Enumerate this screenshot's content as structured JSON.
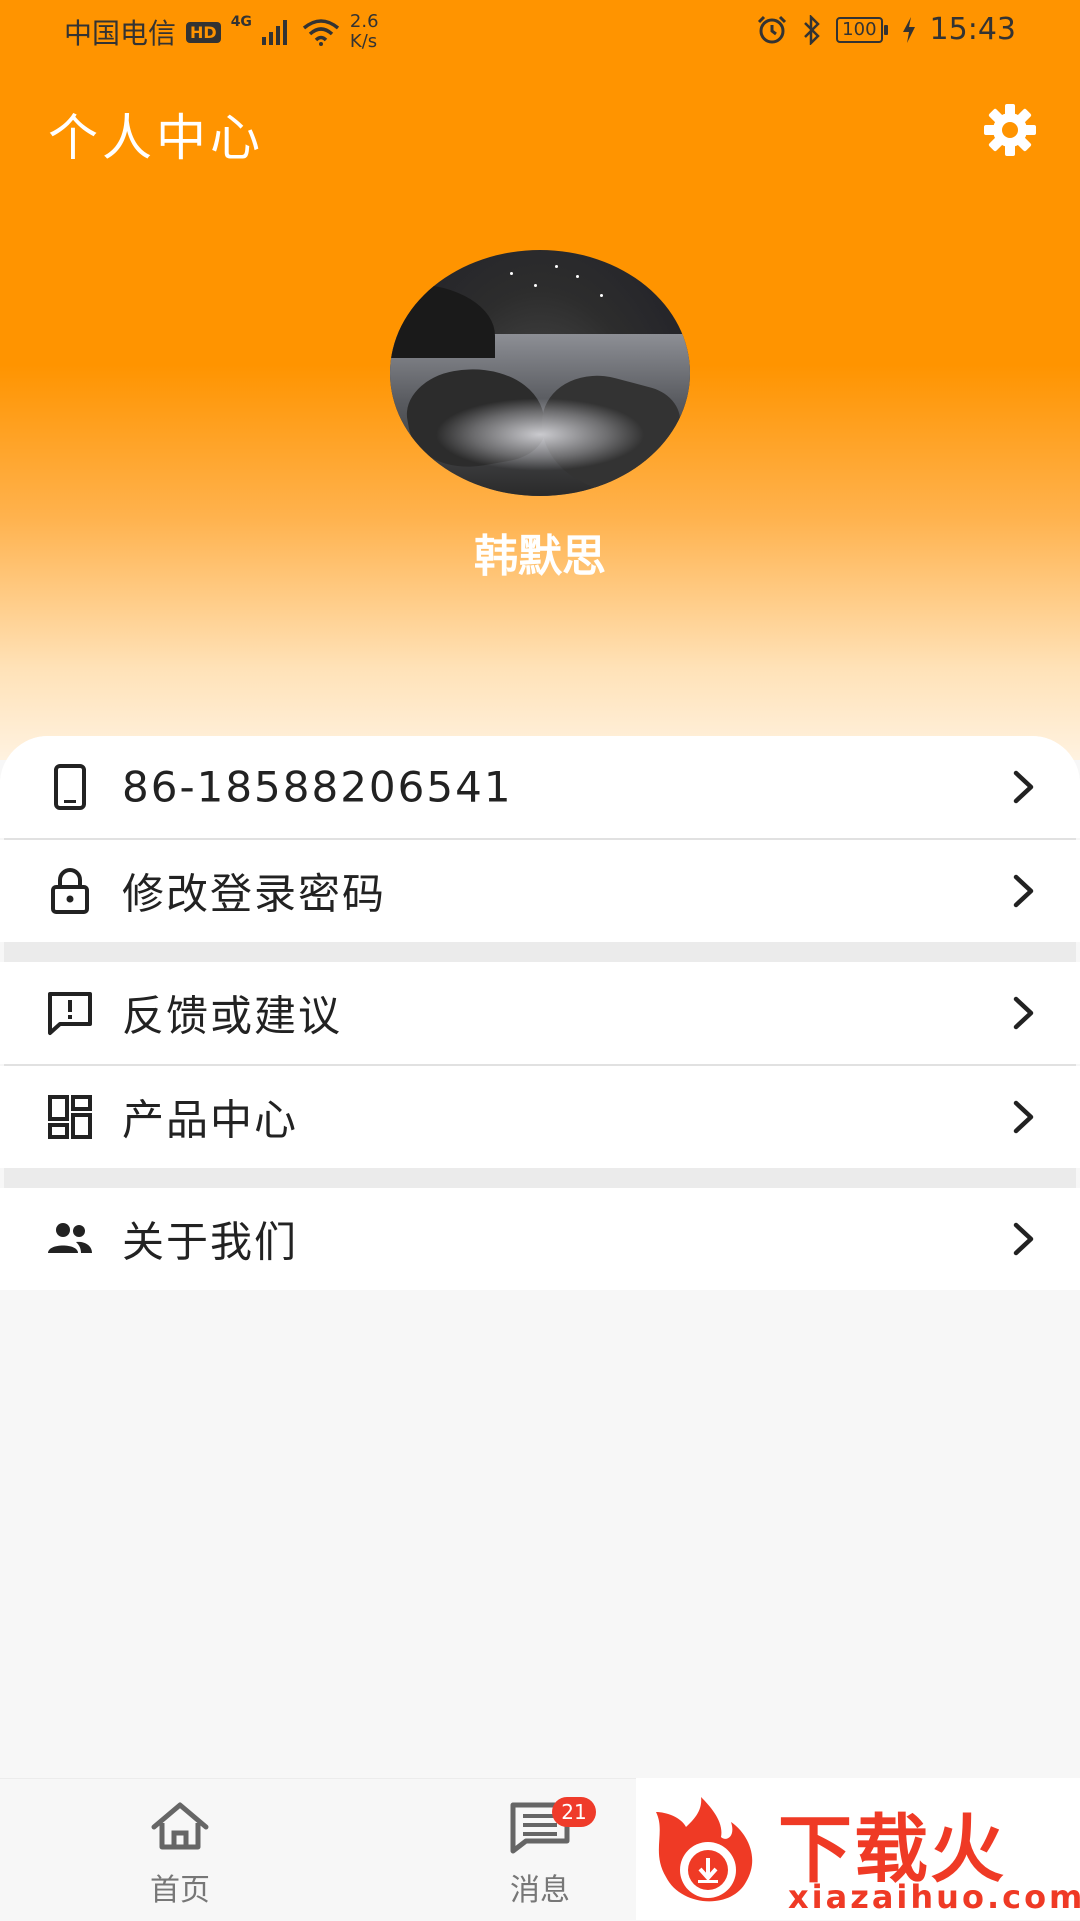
{
  "status_bar": {
    "carrier": "中国电信",
    "hd": "HD",
    "network": "4G",
    "speed_value": "2.6",
    "speed_unit": "K/s",
    "battery": "100",
    "time": "15:43"
  },
  "header": {
    "title": "个人中心",
    "username": "韩默思"
  },
  "menu": {
    "phone": "86-18588206541",
    "change_password": "修改登录密码",
    "feedback": "反馈或建议",
    "product_center": "产品中心",
    "about_us": "关于我们"
  },
  "bottom_nav": {
    "home": "首页",
    "messages": "消息",
    "messages_badge": "21"
  },
  "watermark": {
    "brand": "下载火",
    "url": "xiazaihuo.com"
  },
  "colors": {
    "primary": "#ff9400",
    "badge": "#ef3b2a"
  }
}
